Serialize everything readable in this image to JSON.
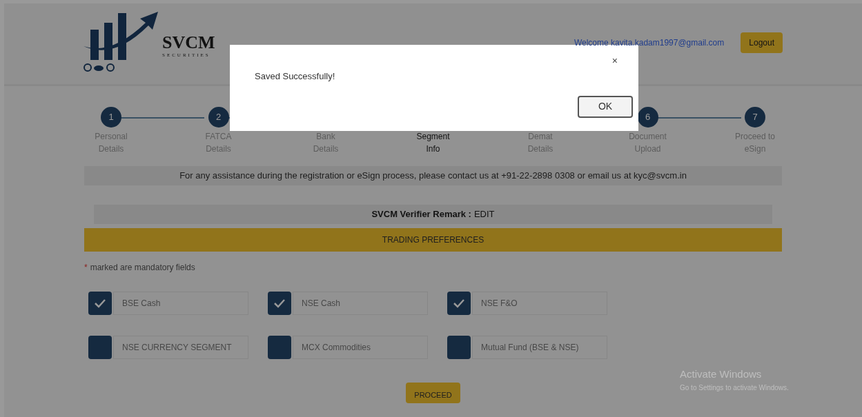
{
  "header": {
    "logo": {
      "name": "SVCM",
      "tagline": "SECURITIES"
    },
    "welcome": "Welcome kavita.kadam1997@gmail.com",
    "logout": "Logout"
  },
  "steps": [
    {
      "number": "1",
      "label": "Personal Details",
      "selected": false
    },
    {
      "number": "2",
      "label": "FATCA Details",
      "selected": false
    },
    {
      "label": "Bank Details",
      "selected": false
    },
    {
      "label": "Segment Info",
      "selected": true
    },
    {
      "label": "Demat Details",
      "selected": false
    },
    {
      "number": "6",
      "label": "Document Upload",
      "selected": false
    },
    {
      "number": "7",
      "label": "Proceed to eSign",
      "selected": false
    }
  ],
  "assistance": "For any assistance during the registration or eSign process, please contact us at +91-22-2898 0308 or email us at kyc@svcm.in",
  "remark": {
    "label": "SVCM Verifier Remark :",
    "value": "EDIT"
  },
  "section_title": "TRADING PREFERENCES",
  "mandatory_note": {
    "mark": "*",
    "text": "marked are mandatory fields"
  },
  "segments": [
    {
      "label": "BSE Cash",
      "checked": true
    },
    {
      "label": "NSE Cash",
      "checked": true
    },
    {
      "label": "NSE F&O",
      "checked": true
    },
    {
      "label": "NSE CURRENCY SEGMENT",
      "checked": false
    },
    {
      "label": "MCX Commodities",
      "checked": false
    },
    {
      "label": "Mutual Fund (BSE & NSE)",
      "checked": false
    }
  ],
  "proceed": "PROCEED",
  "watermark": {
    "title": "Activate Windows",
    "subtitle": "Go to Settings to activate Windows."
  },
  "dialog": {
    "message": "Saved Successfully!",
    "close": "×",
    "ok": "OK"
  }
}
